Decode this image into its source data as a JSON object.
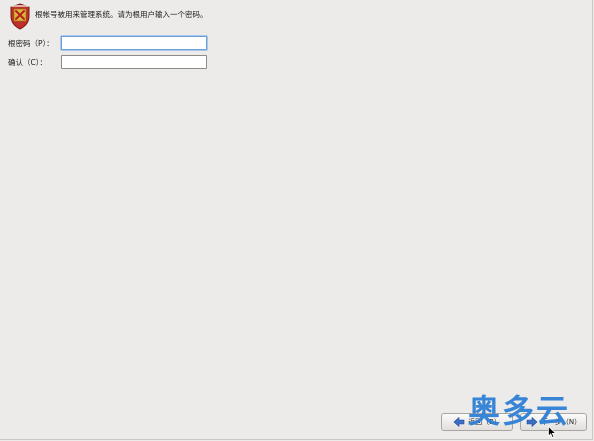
{
  "header": {
    "icon": "root-shield-icon",
    "description": "根帐号被用来管理系统。请为根用户输入一个密码。"
  },
  "form": {
    "password_label": "根密码（P）：",
    "password_value": "",
    "confirm_label": "确认（C）：",
    "confirm_value": ""
  },
  "buttons": {
    "back_label": "返回（B）",
    "next_label": "下一步（N）",
    "back_icon": "arrow-left-icon",
    "next_icon": "arrow-right-icon"
  },
  "watermark": {
    "text": "奥多云"
  },
  "colors": {
    "background": "#ecebe9",
    "focus_border": "#6f9ed6",
    "arrow_blue": "#3a6fc4",
    "watermark_blue": "#2f7fd6",
    "shield_red": "#c0302a",
    "shield_gold": "#e2b33b"
  }
}
